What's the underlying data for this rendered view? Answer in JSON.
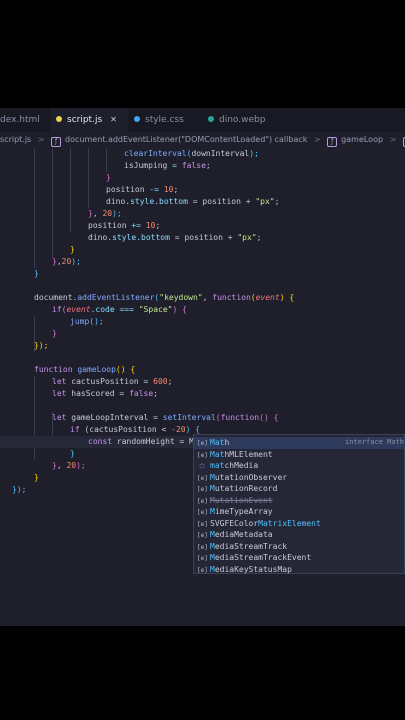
{
  "tabs": [
    {
      "label": "dex.html",
      "active": false,
      "dot": "#e37933"
    },
    {
      "label": "script.js",
      "active": true,
      "dot": "#e8d44d"
    },
    {
      "label": "style.css",
      "active": false,
      "dot": "#42a5f5"
    },
    {
      "label": "dino.webp",
      "active": false,
      "dot": "#26a69a"
    }
  ],
  "tab_close": "✕",
  "breadcrumb": [
    "script.js",
    ">",
    "document.addEventListener(\"DOMContentLoaded\") callback",
    ">",
    "gameLoop",
    ">",
    "gameLoop"
  ],
  "code": {
    "l0": [
      "clearInterval",
      "(",
      "downInterval",
      ");"
    ],
    "l1": [
      "isJumping",
      " = ",
      "false",
      ";"
    ],
    "l2": [
      "}"
    ],
    "l3": [
      "position",
      " -= ",
      "10",
      ";"
    ],
    "l4": [
      "dino",
      ".",
      "style",
      ".",
      "bottom",
      " = position + ",
      "\"px\"",
      ";"
    ],
    "l5": [
      "}",
      ", ",
      "20",
      ");"
    ],
    "l6": [
      "position",
      " += ",
      "10",
      ";"
    ],
    "l7": [
      "dino",
      ".",
      "style",
      ".",
      "bottom",
      " = position + ",
      "\"px\"",
      ";"
    ],
    "l8": [
      "}"
    ],
    "l9": [
      "}",
      ",",
      "20",
      ");"
    ],
    "l10": [
      "}"
    ],
    "l11": [
      "document",
      ".",
      "addEventListener",
      "(",
      "\"keydown\"",
      ", ",
      "function",
      "(",
      "event",
      ") {"
    ],
    "l12": [
      "if",
      "(",
      "event",
      ".",
      "code",
      " === ",
      "\"Space\"",
      ") {"
    ],
    "l13": [
      "jump",
      "();"
    ],
    "l14": [
      "}"
    ],
    "l15": [
      "});"
    ],
    "l16": [
      "function",
      " ",
      "gameLoop",
      "() {"
    ],
    "l17": [
      "let",
      " cactusPosition = ",
      "600",
      ";"
    ],
    "l18": [
      "let",
      " hasScored = ",
      "false",
      ";"
    ],
    "l19": [
      "let",
      " gameLoopInterval = ",
      "setInterval",
      "(",
      "function",
      "() {"
    ],
    "l20": [
      "if",
      " (cactusPosition < ",
      "-20",
      ") {"
    ],
    "l21": [
      "const",
      " randomHeight = Mat"
    ],
    "l22": [
      "}"
    ],
    "l23": [
      "}",
      ", ",
      "20",
      ");"
    ],
    "l24": [
      "}"
    ],
    "l25": [
      "});"
    ]
  },
  "suggestions": [
    {
      "prefix": "Mat",
      "rest": "h",
      "icon": "[e]",
      "detail": "interface Math",
      "selected": true,
      "deprecated": false
    },
    {
      "prefix": "Mat",
      "rest": "hMLElement",
      "icon": "[e]",
      "detail": "",
      "selected": false,
      "deprecated": false
    },
    {
      "prefix": "mat",
      "rest": "chMedia",
      "icon": "⬡",
      "detail": "",
      "selected": false,
      "deprecated": false
    },
    {
      "prefix": "M",
      "rest": "utationObserver",
      "icon": "[e]",
      "detail": "",
      "selected": false,
      "deprecated": false
    },
    {
      "prefix": "M",
      "rest": "utationRecord",
      "icon": "[e]",
      "detail": "",
      "selected": false,
      "deprecated": false
    },
    {
      "prefix": "M",
      "rest": "utationEvent",
      "icon": "[e]",
      "detail": "",
      "selected": false,
      "deprecated": true
    },
    {
      "prefix": "M",
      "rest": "imeTypeArray",
      "icon": "[e]",
      "detail": "",
      "selected": false,
      "deprecated": false
    },
    {
      "prefix": "SVGFEColor",
      "rest": "MatrixElement",
      "icon": "[e]",
      "detail": "",
      "selected": false,
      "deprecated": false
    },
    {
      "prefix": "M",
      "rest": "ediaMetadata",
      "icon": "[e]",
      "detail": "",
      "selected": false,
      "deprecated": false
    },
    {
      "prefix": "M",
      "rest": "ediaStreamTrack",
      "icon": "[e]",
      "detail": "",
      "selected": false,
      "deprecated": false
    },
    {
      "prefix": "M",
      "rest": "ediaStreamTrackEvent",
      "icon": "[e]",
      "detail": "",
      "selected": false,
      "deprecated": false
    },
    {
      "prefix": "M",
      "rest": "ediaKeyStatusMap",
      "icon": "[e]",
      "detail": "",
      "selected": false,
      "deprecated": false
    }
  ]
}
